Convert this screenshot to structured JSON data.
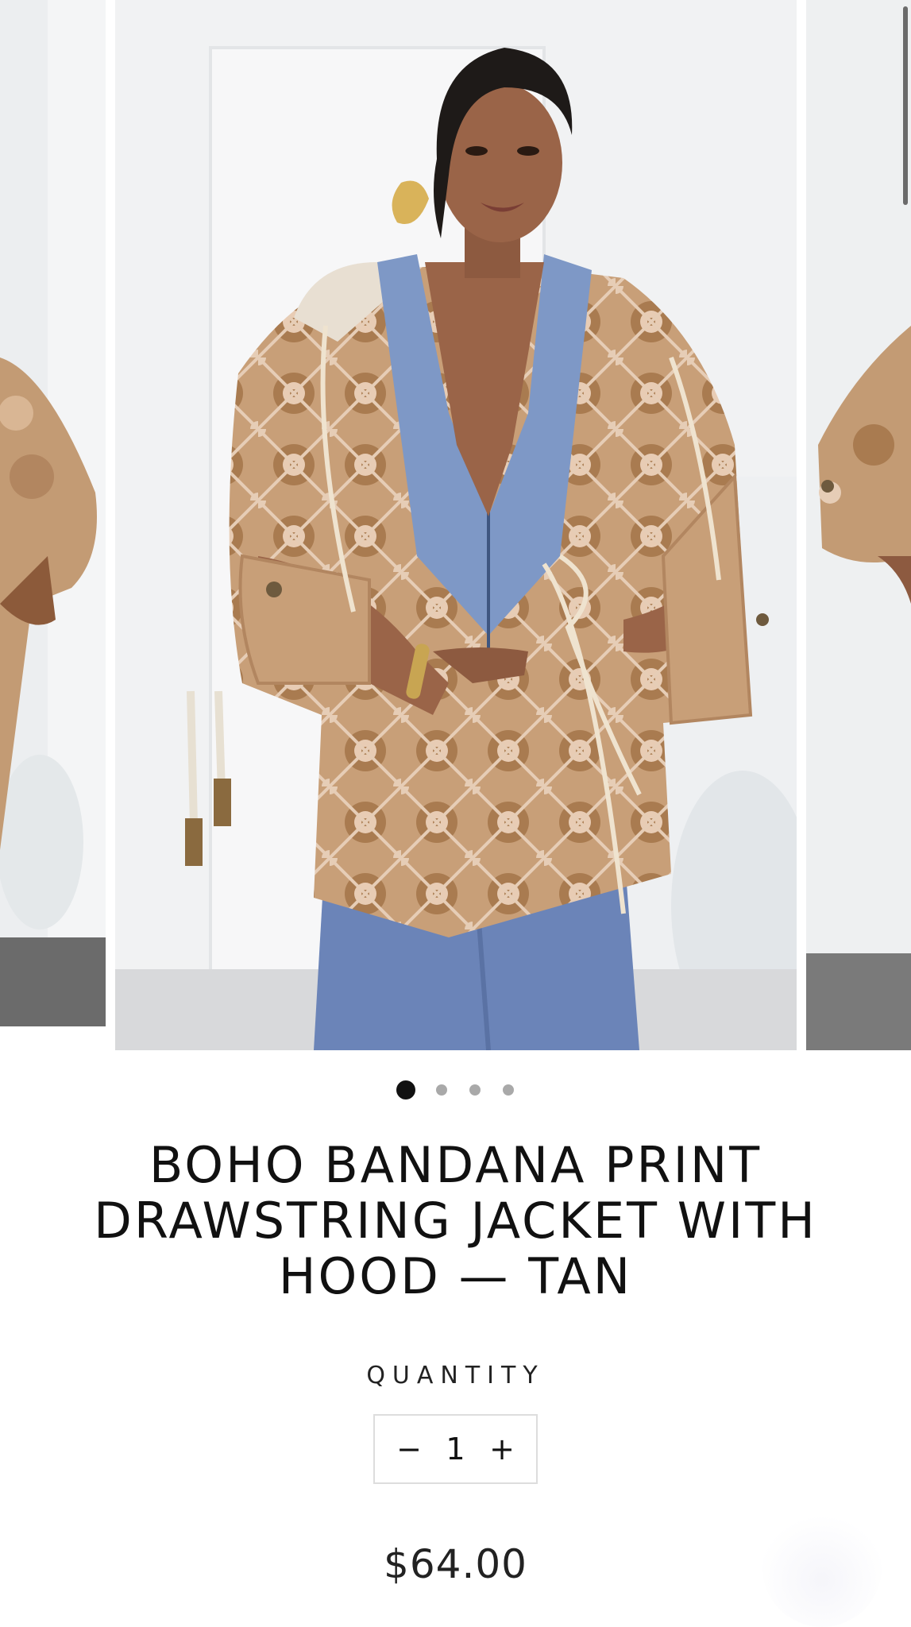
{
  "gallery": {
    "slide_count": 4,
    "active_index": 0
  },
  "product": {
    "title": "BOHO BANDANA PRINT DRAWSTRING JACKET WITH HOOD — TAN",
    "quantity_label": "QUANTITY",
    "quantity_value": "1",
    "decrement_label": "−",
    "increment_label": "+",
    "price": "$64.00"
  },
  "icons": {
    "zoom": "search-icon"
  },
  "colors": {
    "text": "#111111",
    "jacket_tan": "#c49a6c",
    "jeans_blue": "#6b84b8",
    "dot_active": "#111111",
    "dot_inactive": "#a9a9a9"
  }
}
